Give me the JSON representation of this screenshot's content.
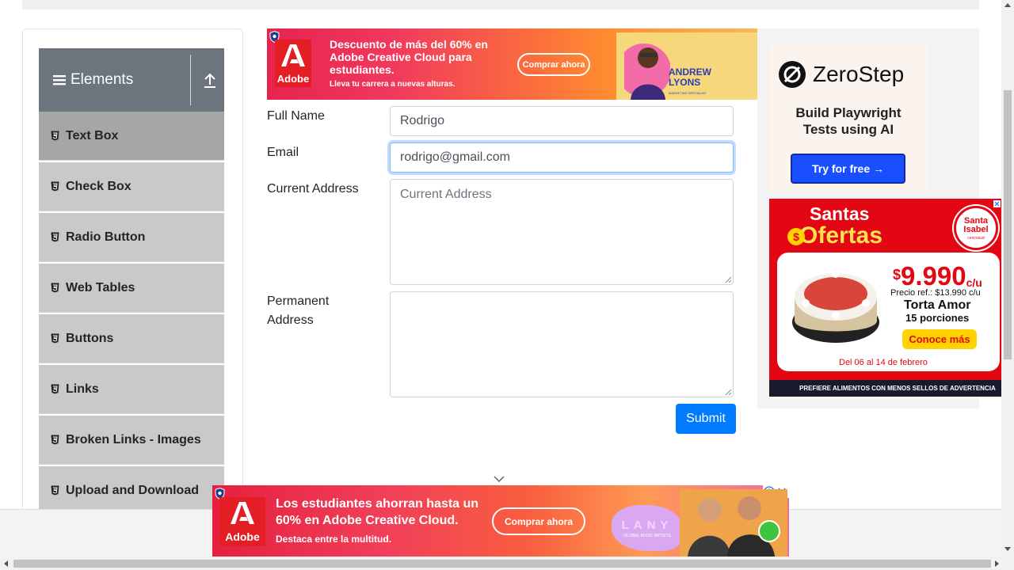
{
  "sidebar": {
    "group_title": "Elements",
    "items": [
      {
        "label": "Text Box",
        "active": true
      },
      {
        "label": "Check Box"
      },
      {
        "label": "Radio Button"
      },
      {
        "label": "Web Tables"
      },
      {
        "label": "Buttons"
      },
      {
        "label": "Links"
      },
      {
        "label": "Broken Links - Images"
      },
      {
        "label": "Upload and Download"
      }
    ]
  },
  "form": {
    "full_name": {
      "label": "Full Name",
      "value": "Rodrigo"
    },
    "email": {
      "label": "Email",
      "value": "rodrigo@gmail.com"
    },
    "current_address": {
      "label": "Current Address",
      "placeholder": "Current Address",
      "value": ""
    },
    "permanent_address": {
      "label_line1": "Permanent",
      "label_line2": "Address",
      "value": ""
    },
    "submit_label": "Submit"
  },
  "ad_top": {
    "brand": "Adobe",
    "headline": [
      "Descuento de más del 60% en",
      "Adobe Creative Cloud para",
      "estudiantes."
    ],
    "tagline": "Lleva tu carrera a nuevas alturas.",
    "cta": "Comprar ahora",
    "person_name": [
      "ANDREW",
      "LYONS"
    ],
    "person_role": "MARKETING SPECIALIST"
  },
  "ad_zerostep": {
    "brand": "ZeroStep",
    "subtitle": [
      "Build Playwright",
      "Tests using AI"
    ],
    "cta": "Try for free →"
  },
  "ad_santa": {
    "title1": "Santas",
    "title2": "Ofertas",
    "brand": [
      "Santa",
      "Isabel"
    ],
    "brand_sub": "cencosud",
    "price": "9.990",
    "price_unit": "c/u",
    "ref_price": "Precio ref.: $13.990 c/u",
    "product": "Torta Amor",
    "portions": "15 porciones",
    "cta": "Conoce más",
    "dates": "Del 06 al 14 de febrero",
    "footer": "PREFIERE ALIMENTOS CON MENOS SELLOS DE ADVERTENCIA"
  },
  "ad_bottom": {
    "brand": "Adobe",
    "headline": [
      "Los estudiantes ahorran hasta un",
      "60% en Adobe Creative Cloud."
    ],
    "tagline": "Destaca entre la multitud.",
    "cta": "Comprar ahora",
    "band": "LANY",
    "band_sub": "GLOBAL MUSIC ARTISTS"
  },
  "colors": {
    "primary": "#007bff",
    "sidebar_header": "#6c757d",
    "menu_item": "#c9c9c9",
    "menu_active": "#a6a6a6"
  }
}
